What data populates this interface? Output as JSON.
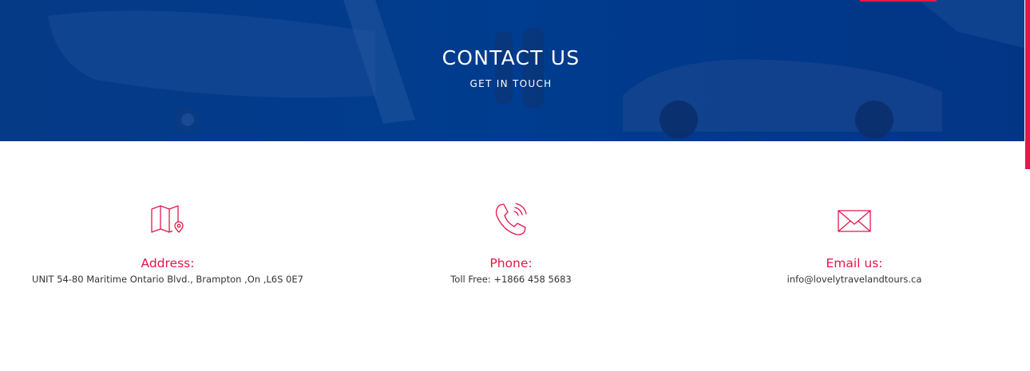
{
  "hero": {
    "title": "CONTACT US",
    "subtitle": "GET IN TOUCH",
    "background_color": "#003a8c"
  },
  "accent_color": "#e8164b",
  "contacts": [
    {
      "icon": "map-pin-icon",
      "label": "Address:",
      "value": "UNIT 54-80 Maritime Ontario Blvd., Brampton ,On ,L6S 0E7"
    },
    {
      "icon": "phone-icon",
      "label": "Phone:",
      "value": "Toll Free: +1866 458 5683"
    },
    {
      "icon": "envelope-icon",
      "label": "Email us:",
      "value": "info@lovelytravelandtours.ca"
    }
  ]
}
